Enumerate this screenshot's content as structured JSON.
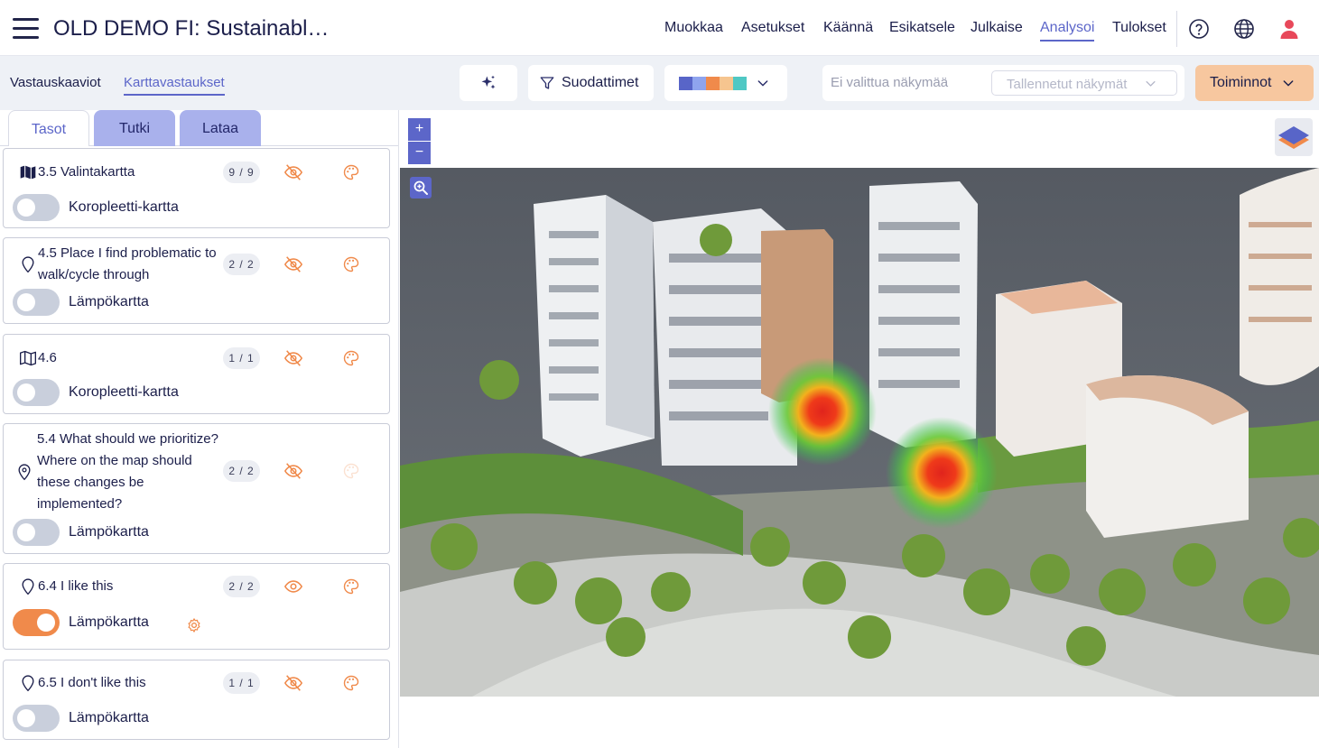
{
  "header": {
    "title": "OLD DEMO FI: Sustainabl…",
    "nav": [
      {
        "label": "Muokkaa"
      },
      {
        "label": "Asetukset"
      },
      {
        "label": "Käännä"
      },
      {
        "label": "Esikatsele"
      },
      {
        "label": "Julkaise"
      },
      {
        "label": "Analysoi",
        "active": true
      },
      {
        "label": "Tulokset"
      }
    ]
  },
  "toolbar": {
    "subtabs": [
      {
        "label": "Vastauskaaviot"
      },
      {
        "label": "Karttavastaukset",
        "active": true
      }
    ],
    "filters_label": "Suodattimet",
    "palette_colors": [
      "#5865c8",
      "#8fa4ee",
      "#f08a4b",
      "#f6c58f",
      "#4fc8c4"
    ],
    "view_placeholder": "Ei valittua näkymää",
    "saved_views_label": "Tallennetut näkymät",
    "actions_label": "Toiminnot"
  },
  "panel": {
    "tabs": [
      {
        "label": "Tasot",
        "active": true
      },
      {
        "label": "Tutki"
      },
      {
        "label": "Lataa"
      }
    ],
    "layers": [
      {
        "title": "3.5 Valintakartta",
        "count": "9 / 9",
        "icon": "map-filled-icon",
        "hidden": true,
        "toggle_label": "Koropleetti-kartta",
        "enabled": false
      },
      {
        "title": "4.5 Place I find problematic to walk/cycle through",
        "count": "2 / 2",
        "icon": "location-pin-icon",
        "hidden": true,
        "toggle_label": "Lämpökartta",
        "enabled": false
      },
      {
        "title": "4.6",
        "count": "1 / 1",
        "icon": "map-outline-icon",
        "hidden": true,
        "toggle_label": "Koropleetti-kartta",
        "enabled": false
      },
      {
        "title": "5.4 What should we prioritize? Where on the map should these changes be implemented?",
        "count": "2 / 2",
        "icon": "location-pin-icon",
        "hidden": true,
        "toggle_label": "Lämpökartta",
        "enabled": false
      },
      {
        "title": "6.4 I like this",
        "count": "2 / 2",
        "icon": "location-pin-icon",
        "hidden": false,
        "toggle_label": "Lämpökartta",
        "enabled": true
      },
      {
        "title": "6.5 I don't like this",
        "count": "1 / 1",
        "icon": "location-pin-icon",
        "hidden": true,
        "toggle_label": "Lämpökartta",
        "enabled": false
      }
    ]
  },
  "map": {
    "zoom_in": "+",
    "zoom_out": "−"
  },
  "colors": {
    "accent": "#5c66c9",
    "orange": "#f08a4b",
    "action_button": "#f7c79f"
  }
}
